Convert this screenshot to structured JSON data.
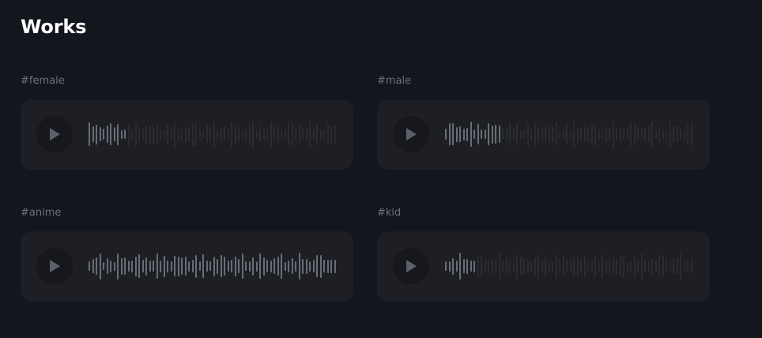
{
  "section": {
    "title": "Works"
  },
  "works": [
    {
      "tag": "#female",
      "progress": 0.16
    },
    {
      "tag": "#male",
      "progress": 0.23
    },
    {
      "tag": "#anime",
      "progress": 1.0
    },
    {
      "tag": "#kid",
      "progress": 0.13
    }
  ],
  "colors": {
    "background": "#13161d",
    "card": "#1d1f25",
    "play_circle": "#16181d",
    "play_icon": "#5d6067",
    "wave_played": "#6a6d74",
    "wave_unplayed": "#2a2c32",
    "tag_text": "#6e7178",
    "title_text": "#ffffff"
  }
}
